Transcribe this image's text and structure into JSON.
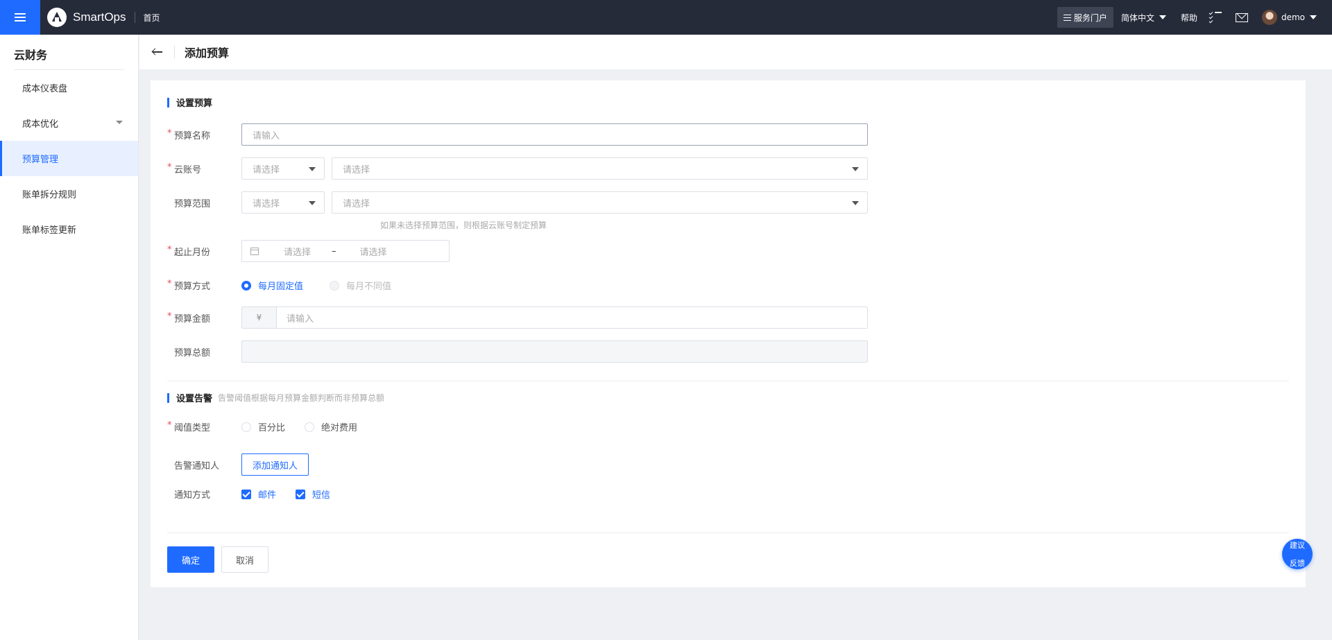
{
  "topbar": {
    "brand": "SmartOps",
    "home": "首页",
    "portal": "服务门户",
    "language": "简体中文",
    "help": "帮助",
    "user": "demo"
  },
  "sidebar": {
    "title": "云财务",
    "items": [
      {
        "label": "成本仪表盘"
      },
      {
        "label": "成本优化"
      },
      {
        "label": "预算管理"
      },
      {
        "label": "账单拆分规则"
      },
      {
        "label": "账单标签更新"
      }
    ]
  },
  "header": {
    "title": "添加预算"
  },
  "budget": {
    "section_title": "设置预算",
    "name_label": "预算名称",
    "name_placeholder": "请输入",
    "account_label": "云账号",
    "account_type_placeholder": "请选择",
    "account_placeholder": "请选择",
    "scope_label": "预算范围",
    "scope_type_placeholder": "请选择",
    "scope_placeholder": "请选择",
    "scope_tip": "如果未选择预算范围，则根据云账号制定预算",
    "period_label": "起止月份",
    "period_start_placeholder": "请选择",
    "period_separator": "–",
    "period_end_placeholder": "请选择",
    "mode_label": "预算方式",
    "mode_fixed": "每月固定值",
    "mode_variable": "每月不同值",
    "amount_label": "预算金额",
    "currency_symbol": "¥",
    "amount_placeholder": "请输入",
    "total_label": "预算总额"
  },
  "alert": {
    "section_title": "设置告警",
    "section_hint": "告警阈值根据每月预算金额判断而非预算总额",
    "threshold_label": "阈值类型",
    "threshold_percent": "百分比",
    "threshold_absolute": "绝对费用",
    "notifier_label": "告警通知人",
    "add_notifier": "添加通知人",
    "method_label": "通知方式",
    "method_email": "邮件",
    "method_sms": "短信"
  },
  "actions": {
    "confirm": "确定",
    "cancel": "取消"
  },
  "feedback": {
    "line1": "建议",
    "line2": "反馈"
  },
  "colors": {
    "primary": "#1f6bff",
    "topbar": "#262b3a",
    "required": "#e34d59"
  }
}
